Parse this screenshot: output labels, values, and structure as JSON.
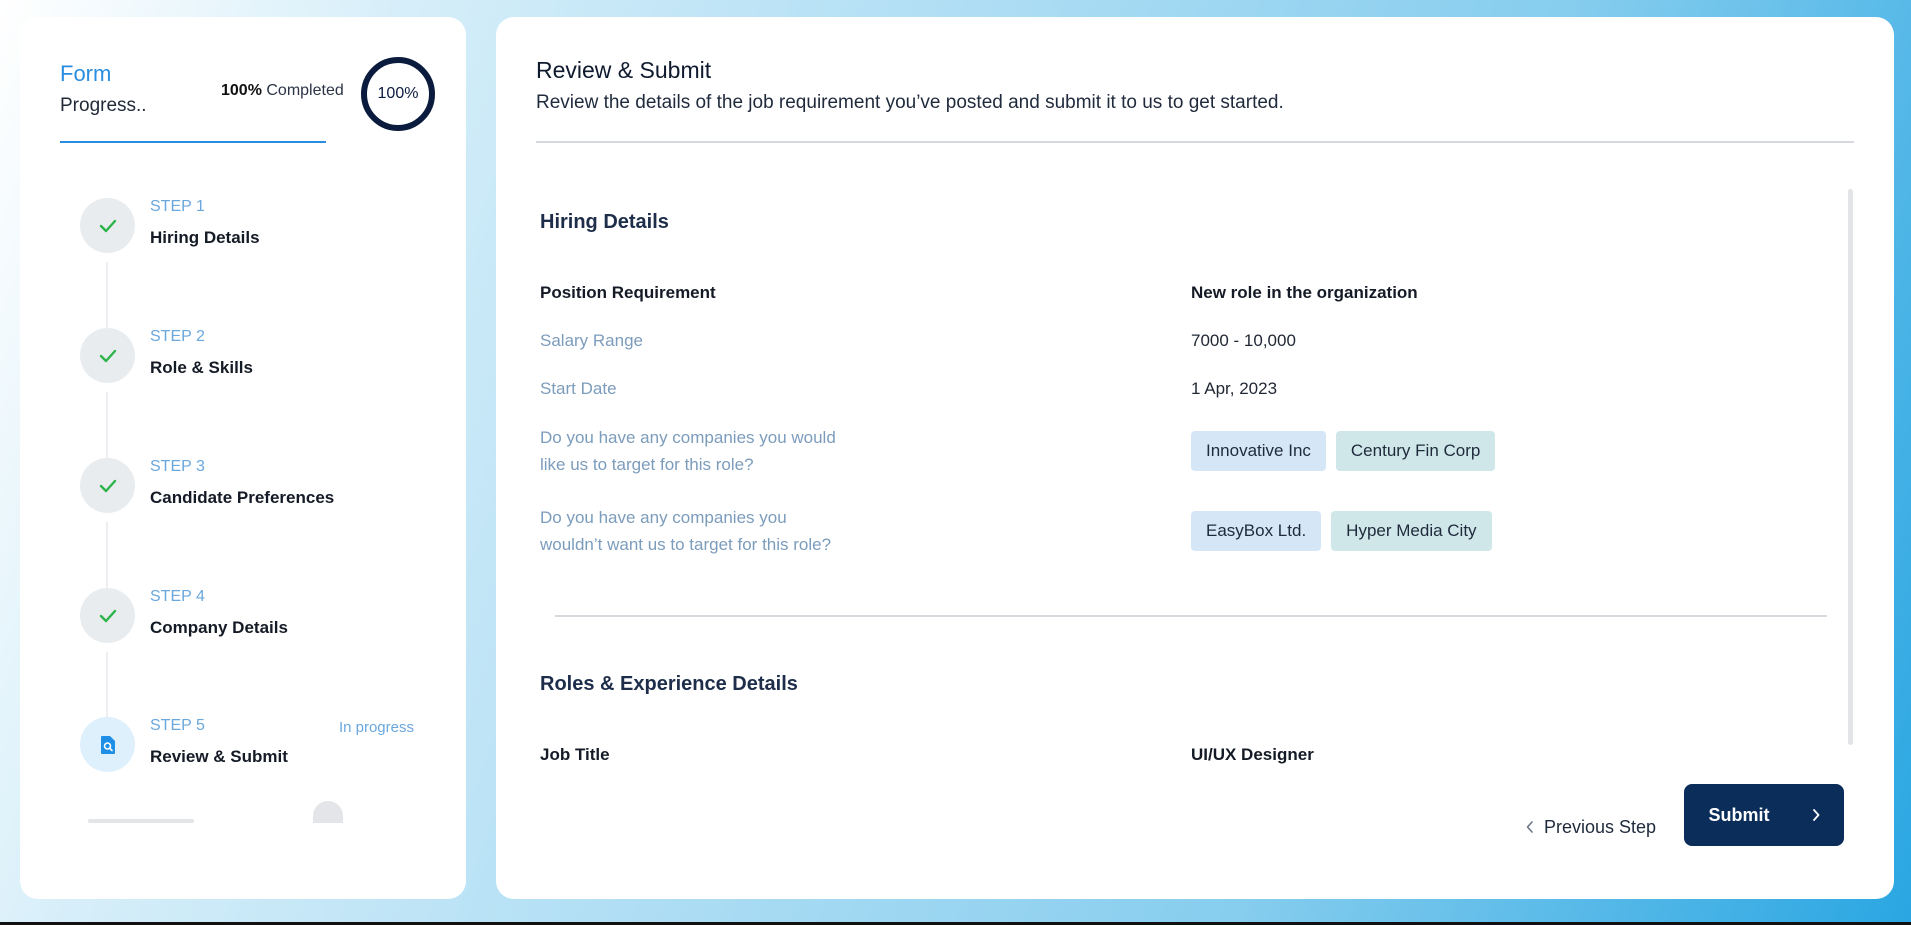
{
  "sidebar": {
    "title": "Form",
    "subtitle": "Progress..",
    "progress_percent": "100%",
    "progress_label": "Completed",
    "ring_label": "100%",
    "progress_value": 1.0,
    "steps": [
      {
        "number": "STEP 1",
        "name": "Hiring Details",
        "state": "done",
        "icon": "check-icon"
      },
      {
        "number": "STEP 2",
        "name": "Role & Skills",
        "state": "done",
        "icon": "check-icon"
      },
      {
        "number": "STEP 3",
        "name": "Candidate Preferences",
        "state": "done",
        "icon": "check-icon"
      },
      {
        "number": "STEP 4",
        "name": "Company Details",
        "state": "done",
        "icon": "check-icon"
      },
      {
        "number": "STEP 5",
        "name": "Review & Submit",
        "state": "in-progress",
        "status": "In progress",
        "icon": "document-search-icon"
      }
    ]
  },
  "main": {
    "title": "Review & Submit",
    "description": "Review the details of the job requirement you’ve posted and submit it to us to get started.",
    "hiring": {
      "title": "Hiring Details",
      "position_label": "Position Requirement",
      "position_value": "New role in the organization",
      "salary_label": "Salary Range",
      "salary_value": "7000 - 10,000",
      "start_label": "Start Date",
      "start_value": "1 Apr, 2023",
      "target_label_line1": "Do you have any companies you would",
      "target_label_line2": "like us to target for this role?",
      "target_chips": [
        "Innovative Inc",
        "Century Fin Corp"
      ],
      "exclude_label_line1": "Do you have any companies you",
      "exclude_label_line2": "wouldn’t want us to target for this role?",
      "exclude_chips": [
        "EasyBox Ltd.",
        "Hyper Media City"
      ]
    },
    "roles": {
      "title": "Roles & Experience Details",
      "job_title_label": "Job Title",
      "job_title_value": "UI/UX Designer"
    },
    "previous_label": "Previous Step",
    "submit_label": "Submit"
  },
  "colors": {
    "accent": "#2a8ee0",
    "navy": "#0a2d5a",
    "check": "#2cb44a"
  }
}
